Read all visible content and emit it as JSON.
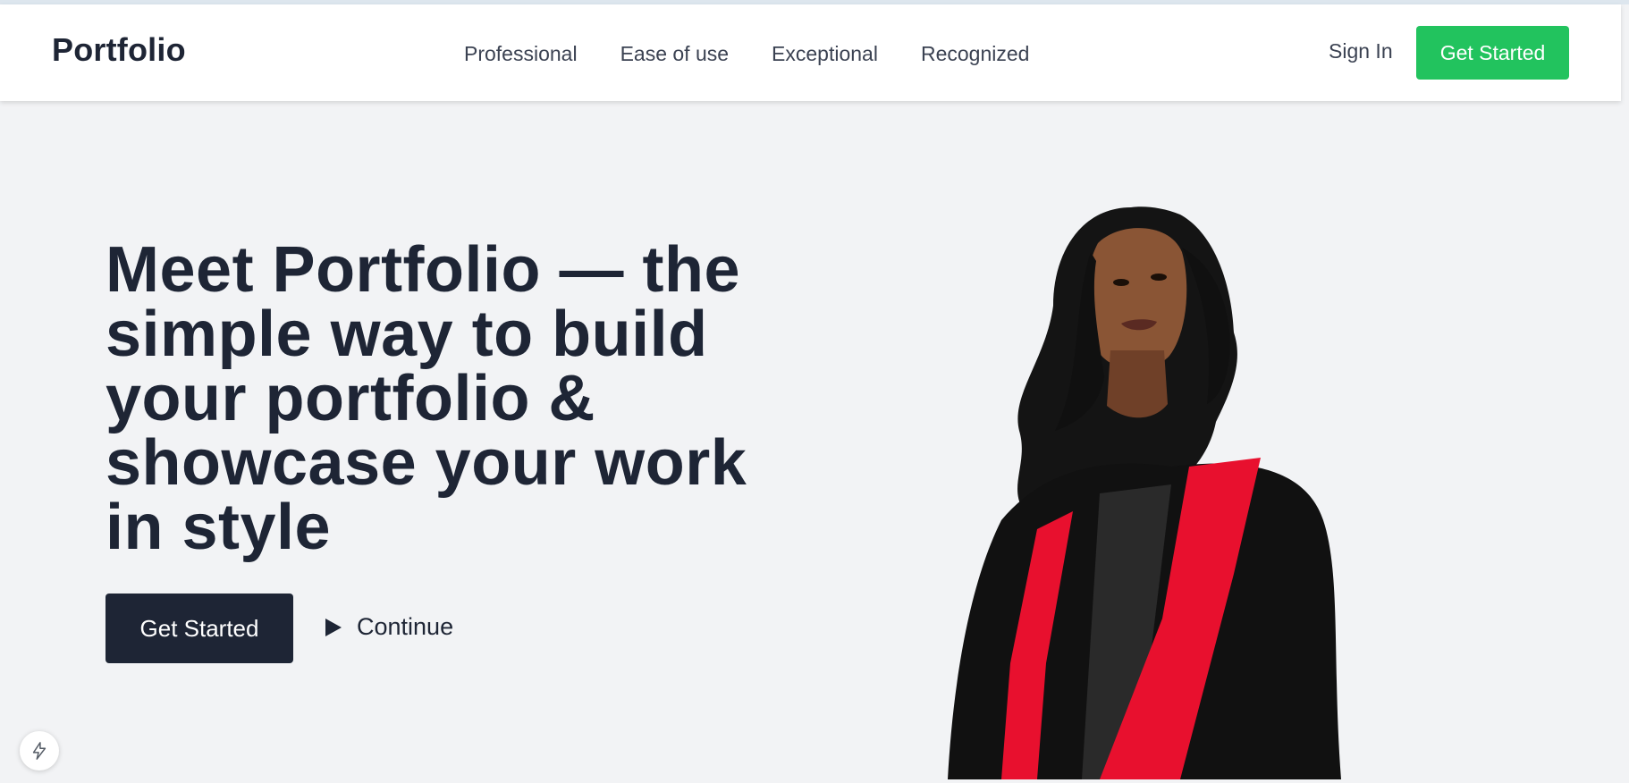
{
  "header": {
    "logo": "Portfolio",
    "nav": [
      "Professional",
      "Ease of use",
      "Exceptional",
      "Recognized"
    ],
    "sign_in": "Sign In",
    "cta": "Get Started"
  },
  "hero": {
    "title": "Meet Portfolio — the simple way to build your portfolio & showcase your work in style",
    "primary_cta": "Get Started",
    "secondary_cta": "Continue"
  },
  "colors": {
    "accent": "#22c35e",
    "dark": "#1e2535",
    "background": "#f2f3f5",
    "gown": "#111111",
    "stole": "#e8102e"
  },
  "icons": {
    "play": "play-icon",
    "bolt": "bolt-icon"
  }
}
